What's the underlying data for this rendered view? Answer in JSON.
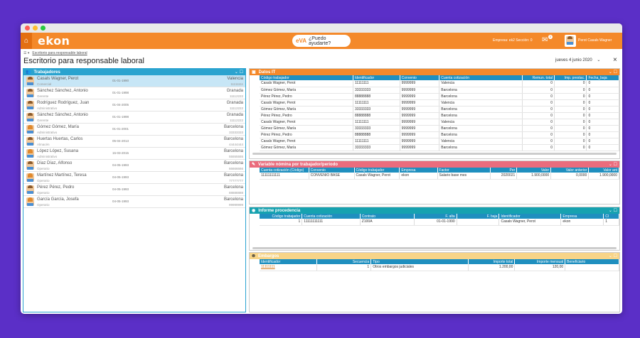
{
  "app": {
    "logo": "ekon",
    "help_label": "¿Puedo ayudarte?",
    "help_brand": "eVA",
    "company": "Empresa: ek2 Sección: 0",
    "notif_count": "2",
    "user": "Perot Casals Wagner"
  },
  "breadcrumb": {
    "link": "Escritorio para responsable laboral"
  },
  "page": {
    "title": "Escritorio para responsable laboral",
    "date": "jueves 4 junio 2020"
  },
  "workers": {
    "title": "Trabajadores",
    "items": [
      {
        "name": "Casals Wagner, Perot",
        "role": "Comercial",
        "date": "01-01-1990",
        "city": "Valencia",
        "code": "11111111",
        "gender": "m"
      },
      {
        "name": "Sánchez Sánchez, Antonio",
        "role": "Gerente",
        "date": "01-01-1998",
        "city": "Granada",
        "code": "11112222",
        "gender": "m"
      },
      {
        "name": "Rodríguez Rodríguez, Juan",
        "role": "Administrativo",
        "date": "01-04-2005",
        "city": "Granada",
        "code": "11112222",
        "gender": "m"
      },
      {
        "name": "Sánchez Sánchez, Antonio",
        "role": "Gerente",
        "date": "01-01-1998",
        "city": "Granada",
        "code": "11112222",
        "gender": "m"
      },
      {
        "name": "Gómez Gómez, María",
        "role": "Administrativo",
        "date": "01-01-2001",
        "city": "Barcelona",
        "code": "33333333",
        "gender": "f"
      },
      {
        "name": "Huertas Huertas, Carlos",
        "role": "Almacén",
        "date": "05-04-2013",
        "city": "Barcelona",
        "code": "44444444",
        "gender": "m"
      },
      {
        "name": "López López, Susana",
        "role": "Administrativo",
        "date": "15-03-2015",
        "city": "Barcelona",
        "code": "55555555",
        "gender": "f"
      },
      {
        "name": "Díaz Díaz, Alfonso",
        "role": "Operario",
        "date": "04-05-1993",
        "city": "Barcelona",
        "code": "66666666",
        "gender": "m"
      },
      {
        "name": "Martínez Martínez, Teresa",
        "role": "Operario",
        "date": "04-05-1993",
        "city": "Barcelona",
        "code": "77777777",
        "gender": "f"
      },
      {
        "name": "Pérez Pérez, Pedro",
        "role": "Operario",
        "date": "04-05-1993",
        "city": "Barcelona",
        "code": "88888888",
        "gender": "m"
      },
      {
        "name": "García García, Josefa",
        "role": "Operario",
        "date": "04-05-1993",
        "city": "Barcelona",
        "code": "99999999",
        "gender": "f"
      }
    ]
  },
  "datos_it": {
    "title": "Datos IT",
    "headers": [
      "Código trabajador",
      "Identificador",
      "Convenio",
      "Cuenta cotización",
      "Remun. total",
      "Imp. prestac.",
      "Fecha_baja"
    ],
    "rows": [
      [
        "Casals Wagner, Perot",
        "11111111",
        "9999999",
        "Valencia",
        "0",
        "0",
        "0"
      ],
      [
        "Gómez Gómez, María",
        "33333333",
        "9999999",
        "Barcelona",
        "0",
        "0",
        "0"
      ],
      [
        "Pérez Pérez, Pedro",
        "88888888",
        "9999999",
        "Barcelona",
        "0",
        "0",
        "0"
      ],
      [
        "Casals Wagner, Perot",
        "11111111",
        "9999999",
        "Valencia",
        "0",
        "0",
        "0"
      ],
      [
        "Gómez Gómez, María",
        "33333333",
        "9999999",
        "Barcelona",
        "0",
        "0",
        "0"
      ],
      [
        "Pérez Pérez, Pedro",
        "88888888",
        "9999999",
        "Barcelona",
        "0",
        "0",
        "0"
      ],
      [
        "Casals Wagner, Perot",
        "11111111",
        "9999999",
        "Valencia",
        "0",
        "0",
        "0"
      ],
      [
        "Gómez Gómez, María",
        "33333333",
        "9999999",
        "Barcelona",
        "0",
        "0",
        "0"
      ],
      [
        "Pérez Pérez, Pedro",
        "88888888",
        "9999999",
        "Barcelona",
        "0",
        "0",
        "0"
      ],
      [
        "Casals Wagner, Perot",
        "11111111",
        "9999999",
        "Valencia",
        "0",
        "0",
        "0"
      ],
      [
        "Gómez Gómez, María",
        "33333333",
        "9999999",
        "Barcelona",
        "0",
        "0",
        "0"
      ]
    ]
  },
  "variable": {
    "title": "Variable nómina por trabajador/periodo",
    "headers": [
      "Cuenta cotización (Código)",
      "Convenio",
      "Código trabajador",
      "Empresa",
      "Factor",
      "Per",
      "Valor",
      "Valor anterior",
      "Valor ant"
    ],
    "rows": [
      [
        "11111111111",
        "CONVENIO BASE",
        "Casals Wagner, Perot",
        "ekon",
        "Salario base mes",
        "2020021",
        "1.900,0000",
        "0,0000",
        "1.900,0000"
      ]
    ]
  },
  "informe": {
    "title": "Informe procedencia",
    "headers": [
      "Código trabajador",
      "Cuenta cotización",
      "Contrato",
      "F. alta",
      "F. baja",
      "Identificador",
      "Empresa",
      "Cl"
    ],
    "rows": [
      [
        "1",
        "11111111111",
        "Z100A",
        "01-01-1990",
        "",
        "Casals Wagner, Perot",
        "ekon",
        "1"
      ]
    ]
  },
  "embargos": {
    "title": "Embargos",
    "headers": [
      "Identificador",
      "Secuencia",
      "Tipo",
      "Importe total",
      "Importe mensual",
      "Beneficiario"
    ],
    "rows": [
      [
        "11111111",
        "1",
        "Otros embargos judiciales",
        "1.200,00",
        "120,00",
        ""
      ]
    ]
  },
  "colors": {
    "accent": "#f4892a",
    "blue": "#2aa3cf",
    "pink": "#ea6c7d",
    "teal": "#17a2b0",
    "yellow": "#f7d488"
  }
}
